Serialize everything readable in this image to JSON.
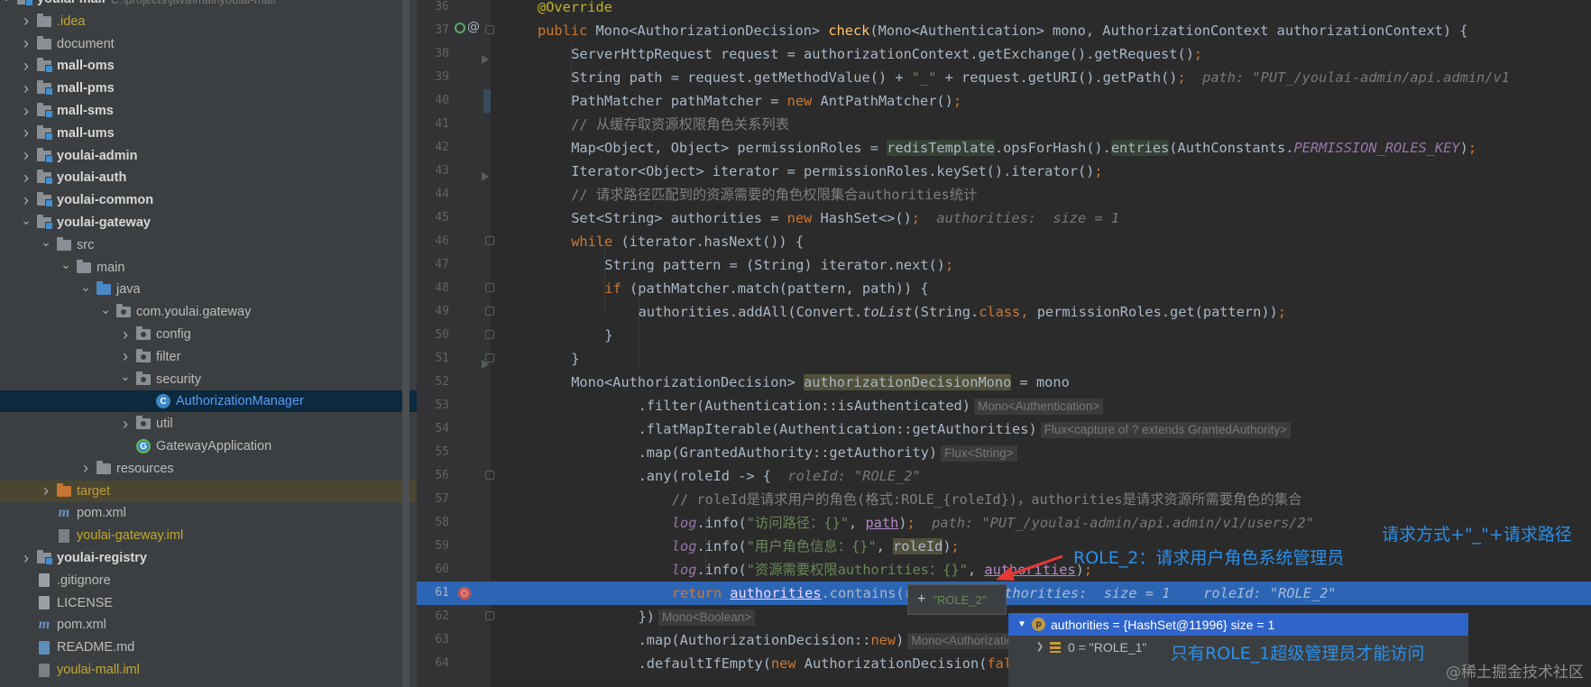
{
  "project": {
    "root_label": "youlai-mall",
    "root_path": "C:\\projects\\java\\mall\\youlai-mall",
    "items": [
      {
        "label": "youlai-mall",
        "path": "C:\\projects\\java\\mall\\youlai-mall",
        "icon": "module-folder-icon",
        "expand": "open",
        "depth": 0,
        "style": "bold"
      },
      {
        "label": ".idea",
        "icon": "folder-icon",
        "expand": "closed",
        "depth": 1,
        "style": "yellow"
      },
      {
        "label": "document",
        "icon": "folder-icon",
        "expand": "closed",
        "depth": 1,
        "style": "normal"
      },
      {
        "label": "mall-oms",
        "icon": "module-folder-icon",
        "expand": "closed",
        "depth": 1,
        "style": "bold"
      },
      {
        "label": "mall-pms",
        "icon": "module-folder-icon",
        "expand": "closed",
        "depth": 1,
        "style": "bold"
      },
      {
        "label": "mall-sms",
        "icon": "module-folder-icon",
        "expand": "closed",
        "depth": 1,
        "style": "bold"
      },
      {
        "label": "mall-ums",
        "icon": "module-folder-icon",
        "expand": "closed",
        "depth": 1,
        "style": "bold"
      },
      {
        "label": "youlai-admin",
        "icon": "module-folder-icon",
        "expand": "closed",
        "depth": 1,
        "style": "bold"
      },
      {
        "label": "youlai-auth",
        "icon": "module-folder-icon",
        "expand": "closed",
        "depth": 1,
        "style": "bold"
      },
      {
        "label": "youlai-common",
        "icon": "module-folder-icon",
        "expand": "closed",
        "depth": 1,
        "style": "bold"
      },
      {
        "label": "youlai-gateway",
        "icon": "module-folder-icon",
        "expand": "open",
        "depth": 1,
        "style": "bold"
      },
      {
        "label": "src",
        "icon": "folder-icon",
        "expand": "open",
        "depth": 2,
        "style": "normal"
      },
      {
        "label": "main",
        "icon": "folder-icon",
        "expand": "open",
        "depth": 3,
        "style": "normal"
      },
      {
        "label": "java",
        "icon": "source-folder-icon",
        "expand": "open",
        "depth": 4,
        "style": "normal"
      },
      {
        "label": "com.youlai.gateway",
        "icon": "package-icon",
        "expand": "open",
        "depth": 5,
        "style": "normal"
      },
      {
        "label": "config",
        "icon": "package-icon",
        "expand": "closed",
        "depth": 6,
        "style": "normal"
      },
      {
        "label": "filter",
        "icon": "package-icon",
        "expand": "closed",
        "depth": 6,
        "style": "normal"
      },
      {
        "label": "security",
        "icon": "package-icon",
        "expand": "open",
        "depth": 6,
        "style": "normal"
      },
      {
        "label": "AuthorizationManager",
        "icon": "class-icon",
        "expand": "none",
        "depth": 7,
        "style": "selected"
      },
      {
        "label": "util",
        "icon": "package-icon",
        "expand": "closed",
        "depth": 6,
        "style": "normal"
      },
      {
        "label": "GatewayApplication",
        "icon": "spring-boot-class-icon",
        "expand": "none",
        "depth": 6,
        "style": "normal"
      },
      {
        "label": "resources",
        "icon": "resources-folder-icon",
        "expand": "closed",
        "depth": 4,
        "style": "normal"
      },
      {
        "label": "target",
        "icon": "excluded-folder-icon",
        "expand": "closed",
        "depth": 2,
        "style": "olive"
      },
      {
        "label": "pom.xml",
        "icon": "maven-icon",
        "expand": "none",
        "depth": 2,
        "style": "normal"
      },
      {
        "label": "youlai-gateway.iml",
        "icon": "iml-file-icon",
        "expand": "none",
        "depth": 2,
        "style": "yellow"
      },
      {
        "label": "youlai-registry",
        "icon": "module-folder-icon",
        "expand": "closed",
        "depth": 1,
        "style": "bold"
      },
      {
        "label": ".gitignore",
        "icon": "file-icon",
        "expand": "none",
        "depth": 1,
        "style": "normal"
      },
      {
        "label": "LICENSE",
        "icon": "file-icon",
        "expand": "none",
        "depth": 1,
        "style": "normal"
      },
      {
        "label": "pom.xml",
        "icon": "maven-icon",
        "expand": "none",
        "depth": 1,
        "style": "normal"
      },
      {
        "label": "README.md",
        "icon": "markdown-file-icon",
        "expand": "none",
        "depth": 1,
        "style": "normal"
      },
      {
        "label": "youlai-mall.iml",
        "icon": "iml-file-icon",
        "expand": "none",
        "depth": 1,
        "style": "yellow"
      }
    ]
  },
  "editor": {
    "execution_line": "61",
    "lines": [
      {
        "n": "36",
        "indent": 1,
        "tokens": [
          [
            "ann",
            "@Override"
          ]
        ]
      },
      {
        "n": "37",
        "indent": 1,
        "tokens": [
          [
            "kw",
            "public "
          ],
          [
            "",
            "Mono<AuthorizationDecision> "
          ],
          [
            "fn",
            "check"
          ],
          [
            "",
            "(Mono<Authentication> mono, AuthorizationContext authorizationContext) {"
          ]
        ]
      },
      {
        "n": "38",
        "indent": 2,
        "tokens": [
          [
            "",
            "ServerHttpRequest request = authorizationContext.getExchange().getRequest()"
          ],
          [
            "kw",
            ";"
          ]
        ]
      },
      {
        "n": "39",
        "indent": 2,
        "tokens": [
          [
            "",
            "String path = request.getMethodValue() + "
          ],
          [
            "str",
            "\"_\""
          ],
          [
            "",
            " + request.getURI().getPath()"
          ],
          [
            "kw",
            ";"
          ],
          [
            "inl",
            "  path: \"PUT_/youlai-admin/api.admin/v1"
          ]
        ]
      },
      {
        "n": "40",
        "indent": 2,
        "tokens": [
          [
            "",
            "PathMatcher pathMatcher = "
          ],
          [
            "kw",
            "new "
          ],
          [
            "",
            "AntPathMatcher()"
          ],
          [
            "kw",
            ";"
          ]
        ]
      },
      {
        "n": "41",
        "indent": 2,
        "tokens": [
          [
            "cm",
            "// 从缓存取资源权限角色关系列表"
          ]
        ]
      },
      {
        "n": "42",
        "indent": 2,
        "tokens": [
          [
            "",
            "Map<Object, Object> permissionRoles = "
          ],
          [
            "hl",
            "redisTemplate"
          ],
          [
            "",
            ".opsForHash()."
          ],
          [
            "hl",
            "entries"
          ],
          [
            "",
            "(AuthConstants."
          ],
          [
            "fld",
            "PERMISSION_ROLES_KEY"
          ],
          [
            "",
            ")"
          ],
          [
            "kw",
            ";"
          ]
        ]
      },
      {
        "n": "43",
        "indent": 2,
        "tokens": [
          [
            "",
            "Iterator<Object> iterator = permissionRoles.keySet().iterator()"
          ],
          [
            "kw",
            ";"
          ]
        ]
      },
      {
        "n": "44",
        "indent": 2,
        "tokens": [
          [
            "cm",
            "// 请求路径匹配到的资源需要的角色权限集合authorities统计"
          ]
        ]
      },
      {
        "n": "45",
        "indent": 2,
        "tokens": [
          [
            "",
            "Set<String> authorities = "
          ],
          [
            "kw",
            "new "
          ],
          [
            "",
            "HashSet<>()"
          ],
          [
            "kw",
            ";"
          ],
          [
            "inl",
            "  authorities:  size = 1"
          ]
        ]
      },
      {
        "n": "46",
        "indent": 2,
        "tokens": [
          [
            "kw",
            "while "
          ],
          [
            "",
            "(iterator.hasNext()) {"
          ]
        ]
      },
      {
        "n": "47",
        "indent": 3,
        "tokens": [
          [
            "",
            "String pattern = (String) iterator.next()"
          ],
          [
            "kw",
            ";"
          ]
        ]
      },
      {
        "n": "48",
        "indent": 3,
        "tokens": [
          [
            "kw",
            "if "
          ],
          [
            "",
            "(pathMatcher.match(pattern, path)) {"
          ]
        ]
      },
      {
        "n": "49",
        "indent": 4,
        "tokens": [
          [
            "",
            "authorities.addAll(Convert."
          ],
          [
            "italic",
            "toList"
          ],
          [
            "",
            "(String."
          ],
          [
            "kw",
            "class, "
          ],
          [
            "",
            "permissionRoles.get(pattern))"
          ],
          [
            "kw",
            ";"
          ]
        ]
      },
      {
        "n": "50",
        "indent": 3,
        "tokens": [
          [
            "",
            "}"
          ]
        ]
      },
      {
        "n": "51",
        "indent": 2,
        "tokens": [
          [
            "",
            "}"
          ]
        ]
      },
      {
        "n": "52",
        "indent": 2,
        "tokens": [
          [
            "",
            "Mono<AuthorizationDecision> "
          ],
          [
            "hl2",
            "authorizationDecisionMono"
          ],
          [
            "",
            " = mono"
          ]
        ]
      },
      {
        "n": "53",
        "indent": 4,
        "tokens": [
          [
            "",
            ".filter(Authentication::isAuthenticated)"
          ],
          [
            "hint",
            "Mono<Authentication>"
          ]
        ]
      },
      {
        "n": "54",
        "indent": 4,
        "tokens": [
          [
            "",
            ".flatMapIterable(Authentication::getAuthorities)"
          ],
          [
            "hint",
            "Flux<capture of ? extends GrantedAuthority>"
          ]
        ]
      },
      {
        "n": "55",
        "indent": 4,
        "tokens": [
          [
            "",
            ".map(GrantedAuthority::getAuthority)"
          ],
          [
            "hint",
            "Flux<String>"
          ]
        ]
      },
      {
        "n": "56",
        "indent": 4,
        "tokens": [
          [
            "",
            ".any(roleId -> {"
          ],
          [
            "inl",
            "  roleId: \"ROLE_2\""
          ]
        ]
      },
      {
        "n": "57",
        "indent": 5,
        "tokens": [
          [
            "cm",
            "// roleId是请求用户的角色(格式:ROLE_{roleId})，authorities是请求资源所需要角色的集合"
          ]
        ]
      },
      {
        "n": "58",
        "indent": 5,
        "tokens": [
          [
            "fld",
            "log"
          ],
          [
            "",
            ".info("
          ],
          [
            "str",
            "\"访问路径：{}\""
          ],
          [
            "",
            ", "
          ],
          [
            "ul",
            "path"
          ],
          [
            "",
            ")"
          ],
          [
            "kw",
            ";"
          ],
          [
            "inl",
            "  path: \"PUT_/youlai-admin/api.admin/v1/users/2\""
          ]
        ]
      },
      {
        "n": "59",
        "indent": 5,
        "tokens": [
          [
            "fld",
            "log"
          ],
          [
            "",
            ".info("
          ],
          [
            "str",
            "\"用户角色信息：{}\""
          ],
          [
            "",
            ", "
          ],
          [
            "hl2",
            "roleId"
          ],
          [
            "",
            ")"
          ],
          [
            "kw",
            ";"
          ]
        ]
      },
      {
        "n": "60",
        "indent": 5,
        "tokens": [
          [
            "fld",
            "log"
          ],
          [
            "",
            ".info("
          ],
          [
            "str",
            "\"资源需要权限authorities：{}\""
          ],
          [
            "",
            ", "
          ],
          [
            "ul",
            "authorities"
          ],
          [
            "",
            ")"
          ],
          [
            "kw",
            ";"
          ]
        ]
      },
      {
        "n": "61",
        "indent": 5,
        "tokens": [
          [
            "kw",
            "return "
          ],
          [
            "ul",
            "authorities"
          ],
          [
            "",
            ".contains(roleId)"
          ],
          [
            "kw",
            ";"
          ],
          [
            "inl",
            "  authorities:  size = 1    roleId: \"ROLE_2\""
          ]
        ]
      },
      {
        "n": "62",
        "indent": 4,
        "tokens": [
          [
            "",
            "})"
          ],
          [
            "hint",
            "Mono<Boolean>"
          ]
        ]
      },
      {
        "n": "63",
        "indent": 4,
        "tokens": [
          [
            "",
            ".map(AuthorizationDecision::"
          ],
          [
            "kw",
            "new"
          ],
          [
            "",
            ")"
          ],
          [
            "hint",
            "Mono<AuthorizationDecision>"
          ]
        ]
      },
      {
        "n": "64",
        "indent": 4,
        "tokens": [
          [
            "",
            ".defaultIfEmpty("
          ],
          [
            "kw",
            "new "
          ],
          [
            "",
            "AuthorizationDecision("
          ],
          [
            "kw",
            "false"
          ],
          [
            "",
            "))"
          ],
          [
            "kw",
            ";"
          ]
        ]
      }
    ]
  },
  "debug": {
    "value_popup": {
      "plus": "+",
      "value": "\"ROLE_2\""
    },
    "tree": {
      "row1": {
        "badge": "p",
        "text": "authorities = {HashSet@11996}  size = 1"
      },
      "row2": {
        "text": "0 = \"ROLE_1\""
      }
    }
  },
  "annotations": {
    "method_path": "请求方式+\"_\"+请求路径",
    "user_role": "ROLE_2：请求用户角色系统管理员",
    "required_role": "只有ROLE_1超级管理员才能访问"
  },
  "watermark": "@稀土掘金技术社区",
  "colors": {
    "accent": "#2b8fea",
    "arrow": "#e53935",
    "execution_line": "#2d65b5",
    "selection": "#0d293e"
  }
}
